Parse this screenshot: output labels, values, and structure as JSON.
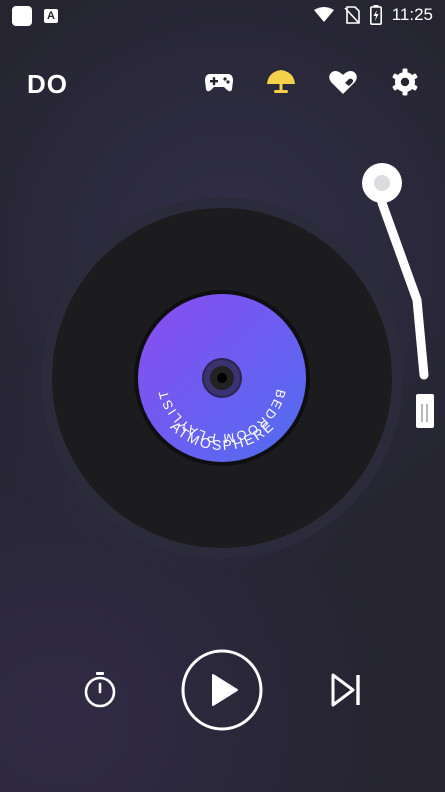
{
  "status_bar": {
    "time": "11:25",
    "app_badge_letter": "A",
    "icons": [
      "app-square-icon",
      "a-badge-icon",
      "wifi-icon",
      "no-sim-icon",
      "battery-charging-icon"
    ]
  },
  "header": {
    "logo": "DO",
    "icons": [
      "gamepad-icon",
      "lamp-icon",
      "heart-icon",
      "gear-icon"
    ]
  },
  "record": {
    "label_top": "BEDROOM  PLAYLIST",
    "label_bottom": "ATMOSPHERE",
    "label_colors": [
      "#8b4cf0",
      "#4f6ef0"
    ]
  },
  "controls": {
    "icons": [
      "timer-icon",
      "play-icon",
      "skip-next-icon"
    ]
  },
  "colors": {
    "background": "#25242f",
    "lamp_accent": "#f5d04a",
    "vinyl": "#1c1c1e"
  }
}
